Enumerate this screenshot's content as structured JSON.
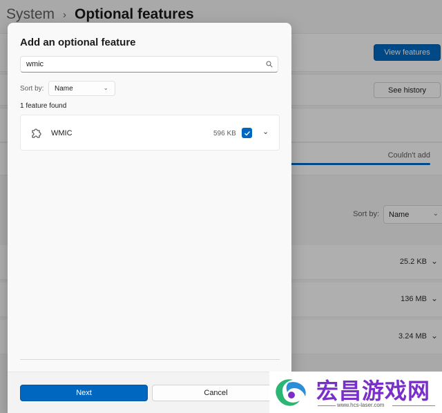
{
  "background": {
    "breadcrumb_parent": "System",
    "breadcrumb_separator": "›",
    "page_title": "Optional features",
    "view_features_label": "View features",
    "see_history_label": "See history",
    "status_text": "Couldn't add",
    "sort_label": "Sort by:",
    "sort_value": "Name",
    "installed_sizes": [
      "25.2 KB",
      "136 MB",
      "3.24 MB"
    ]
  },
  "dialog": {
    "title": "Add an optional feature",
    "search_value": "wmic",
    "sort_label": "Sort by:",
    "sort_value": "Name",
    "found_text": "1 feature found",
    "feature": {
      "name": "WMIC",
      "size": "596 KB",
      "checked": true
    },
    "next_label": "Next",
    "cancel_label": "Cancel"
  },
  "watermark": {
    "text": "宏昌游戏网",
    "url": "www.hcs-laser.com"
  },
  "colors": {
    "accent": "#0067c0",
    "watermark": "#7a2fc9"
  },
  "icons": [
    "search-icon",
    "puzzle-icon",
    "checkmark-icon",
    "chevron-down-icon",
    "chevron-right-icon"
  ]
}
